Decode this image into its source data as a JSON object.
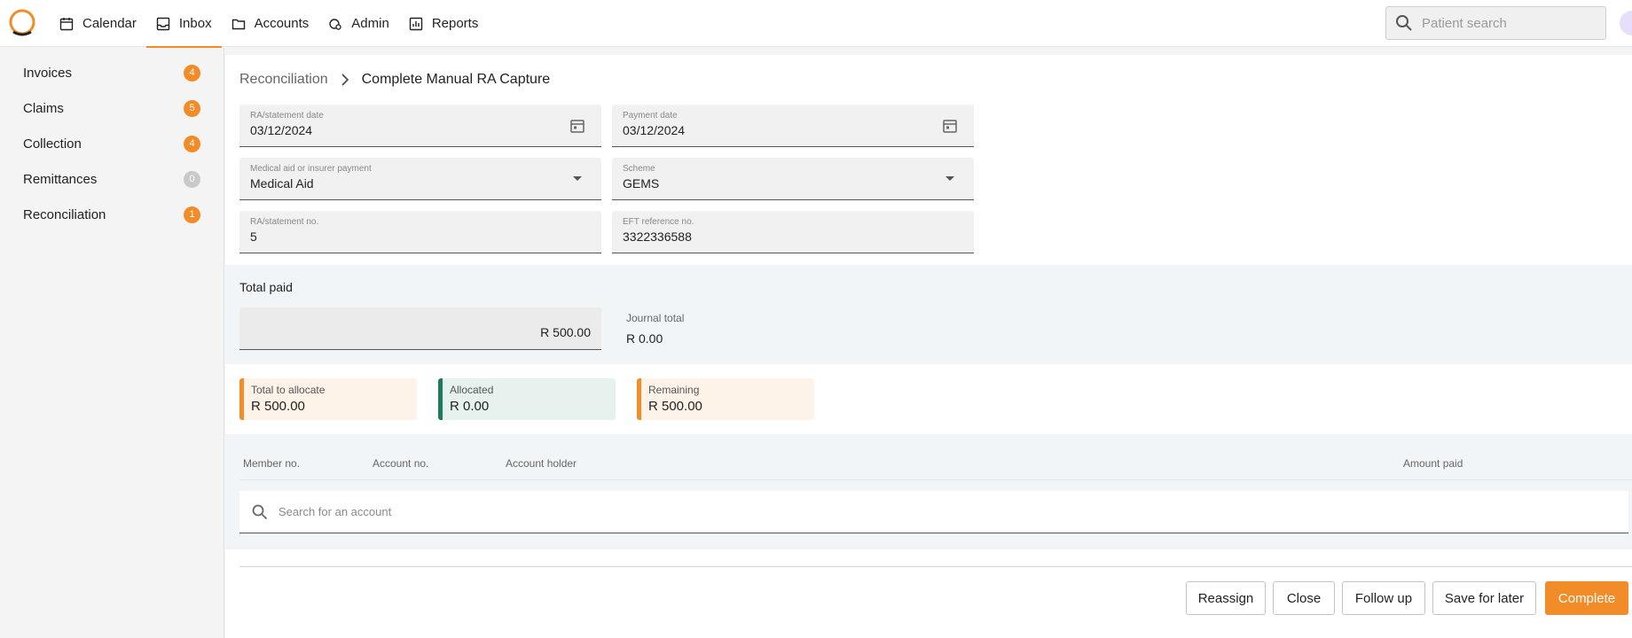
{
  "nav": {
    "items": [
      {
        "label": "Calendar",
        "icon": "calendar-icon"
      },
      {
        "label": "Inbox",
        "icon": "inbox-icon",
        "active": true
      },
      {
        "label": "Accounts",
        "icon": "folder-icon"
      },
      {
        "label": "Admin",
        "icon": "admin-icon"
      },
      {
        "label": "Reports",
        "icon": "reports-icon"
      }
    ],
    "search_placeholder": "Patient search"
  },
  "sidebar": {
    "items": [
      {
        "label": "Invoices",
        "count": "4"
      },
      {
        "label": "Claims",
        "count": "5"
      },
      {
        "label": "Collection",
        "count": "4"
      },
      {
        "label": "Remittances",
        "count": "0"
      },
      {
        "label": "Reconciliation",
        "count": "1"
      }
    ]
  },
  "breadcrumb": {
    "parent": "Reconciliation",
    "current": "Complete Manual RA Capture"
  },
  "form": {
    "ra_date": {
      "label": "RA/statement date",
      "value": "03/12/2024"
    },
    "payment_date": {
      "label": "Payment date",
      "value": "03/12/2024"
    },
    "payer_type": {
      "label": "Medical aid or insurer payment",
      "value": "Medical Aid"
    },
    "scheme": {
      "label": "Scheme",
      "value": "GEMS"
    },
    "ra_no": {
      "label": "RA/statement no.",
      "value": "5"
    },
    "eft_ref": {
      "label": "EFT reference no.",
      "value": "3322336588"
    }
  },
  "totals": {
    "total_paid_label": "Total paid",
    "total_paid_value": "R 500.00",
    "journal_label": "Journal total",
    "journal_value": "R 0.00"
  },
  "allocation": {
    "total_label": "Total to allocate",
    "total_value": "R 500.00",
    "allocated_label": "Allocated",
    "allocated_value": "R 0.00",
    "remaining_label": "Remaining",
    "remaining_value": "R 500.00"
  },
  "table": {
    "headers": [
      "Member no.",
      "Account no.",
      "Account holder",
      "Amount paid"
    ],
    "search_placeholder": "Search for an account"
  },
  "actions": {
    "reassign": "Reassign",
    "close": "Close",
    "follow_up": "Follow up",
    "save_later": "Save for later",
    "complete": "Complete"
  },
  "colors": {
    "accent": "#f28c28",
    "allocated": "#1f7a5a"
  }
}
